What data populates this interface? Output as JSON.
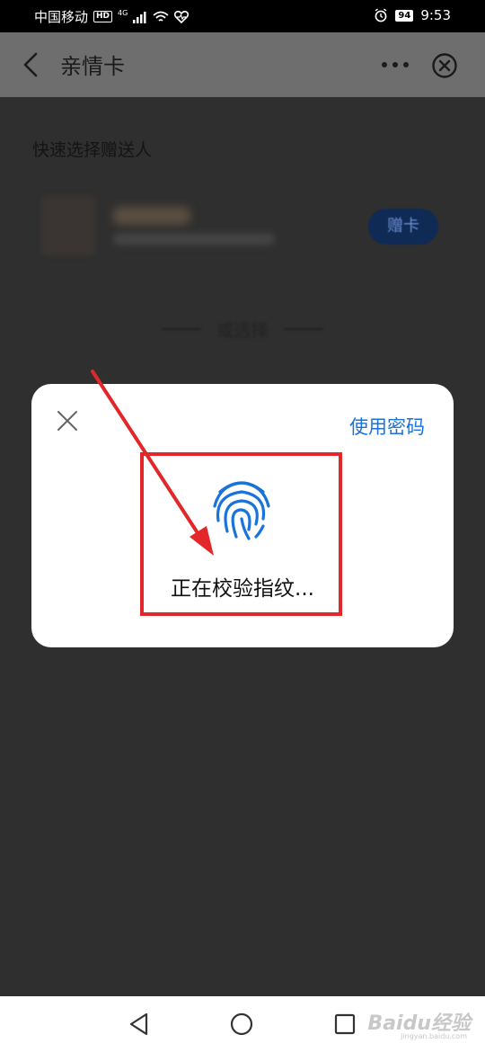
{
  "status_bar": {
    "carrier": "中国移动",
    "hd": "HD",
    "network": "4G",
    "battery": "94",
    "time": "9:53"
  },
  "header": {
    "title": "亲情卡",
    "icons": [
      "back-chevron-icon",
      "more-icon",
      "close-circle-icon"
    ]
  },
  "content": {
    "section_title": "快速选择赠送人",
    "gift_button": "赠卡",
    "divider_label": "或选择"
  },
  "dialog": {
    "use_password": "使用密码",
    "status_text": "正在校验指纹...",
    "icons": [
      "close-icon",
      "fingerprint-icon"
    ]
  },
  "watermark": {
    "brand": "Baidu经验",
    "url": "jingyan.baidu.com"
  },
  "colors": {
    "accent": "#1a73d9",
    "annotation": "#e2262a",
    "overlay": "#2f2f2f"
  }
}
